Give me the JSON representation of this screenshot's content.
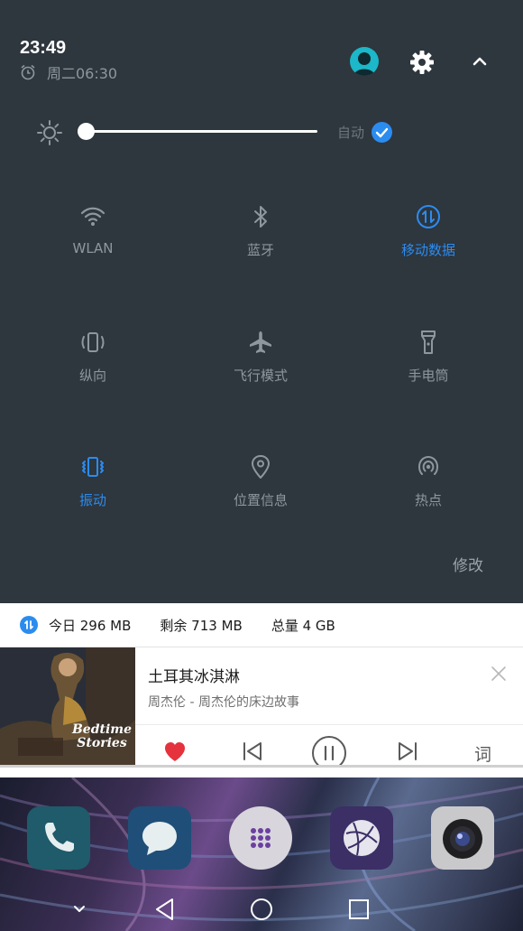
{
  "status": {
    "time": "23:49",
    "alarm": "周二06:30"
  },
  "brightness": {
    "level": 0.0,
    "auto_label": "自动",
    "auto_checked": true
  },
  "tiles": [
    {
      "label": "WLAN",
      "icon": "wifi-icon",
      "active": false
    },
    {
      "label": "蓝牙",
      "icon": "bluetooth-icon",
      "active": false
    },
    {
      "label": "移动数据",
      "icon": "mobile-data-icon",
      "active": true
    },
    {
      "label": "纵向",
      "icon": "portrait-icon",
      "active": false
    },
    {
      "label": "飞行模式",
      "icon": "airplane-icon",
      "active": false
    },
    {
      "label": "手电筒",
      "icon": "flashlight-icon",
      "active": false
    },
    {
      "label": "振动",
      "icon": "vibrate-icon",
      "active": true
    },
    {
      "label": "位置信息",
      "icon": "location-icon",
      "active": false
    },
    {
      "label": "热点",
      "icon": "hotspot-icon",
      "active": false
    }
  ],
  "edit_label": "修改",
  "data_usage": {
    "today": "今日 296 MB",
    "remaining": "剩余 713 MB",
    "total": "总量 4 GB"
  },
  "music": {
    "title": "土耳其冰淇淋",
    "artist": "周杰伦 - 周杰伦的床边故事",
    "cover_text": "Bedtime Stories",
    "lyrics_label": "词"
  },
  "colors": {
    "accent": "#2b8cf0",
    "shade_bg": "#2e363e",
    "inactive": "#8e979e",
    "heart": "#e5323c"
  }
}
